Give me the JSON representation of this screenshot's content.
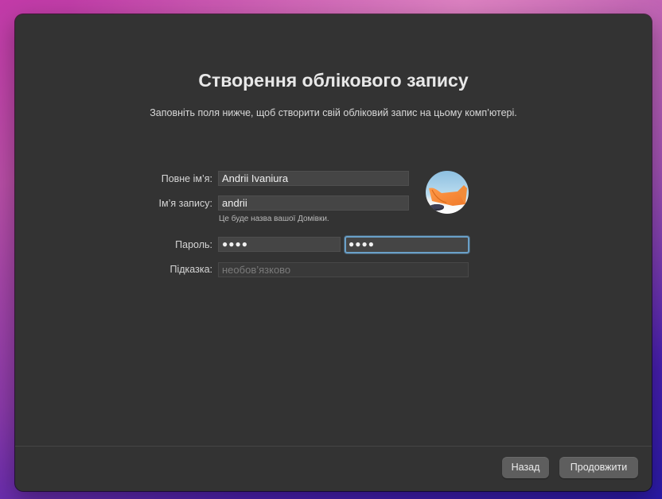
{
  "dialog": {
    "title": "Створення облікового запису",
    "subtitle": "Заповніть поля нижче, щоб створити свій обліковий запис на цьому комп’ютері."
  },
  "form": {
    "full_name": {
      "label": "Повне ім’я:",
      "value": "Andrii Ivaniura"
    },
    "account_name": {
      "label": "Ім’я запису:",
      "value": "andrii",
      "help": "Це буде назва вашої Домівки."
    },
    "password": {
      "label": "Пароль:",
      "value": "●●●●",
      "verify_value": "●●●●"
    },
    "hint": {
      "label": "Підказка:",
      "placeholder": "необов’язково"
    }
  },
  "buttons": {
    "back": "Назад",
    "continue": "Продовжити"
  },
  "colors": {
    "window_bg": "#333333",
    "focus_ring": "#6aa0c8",
    "button_bg": "#5e5e5e"
  }
}
